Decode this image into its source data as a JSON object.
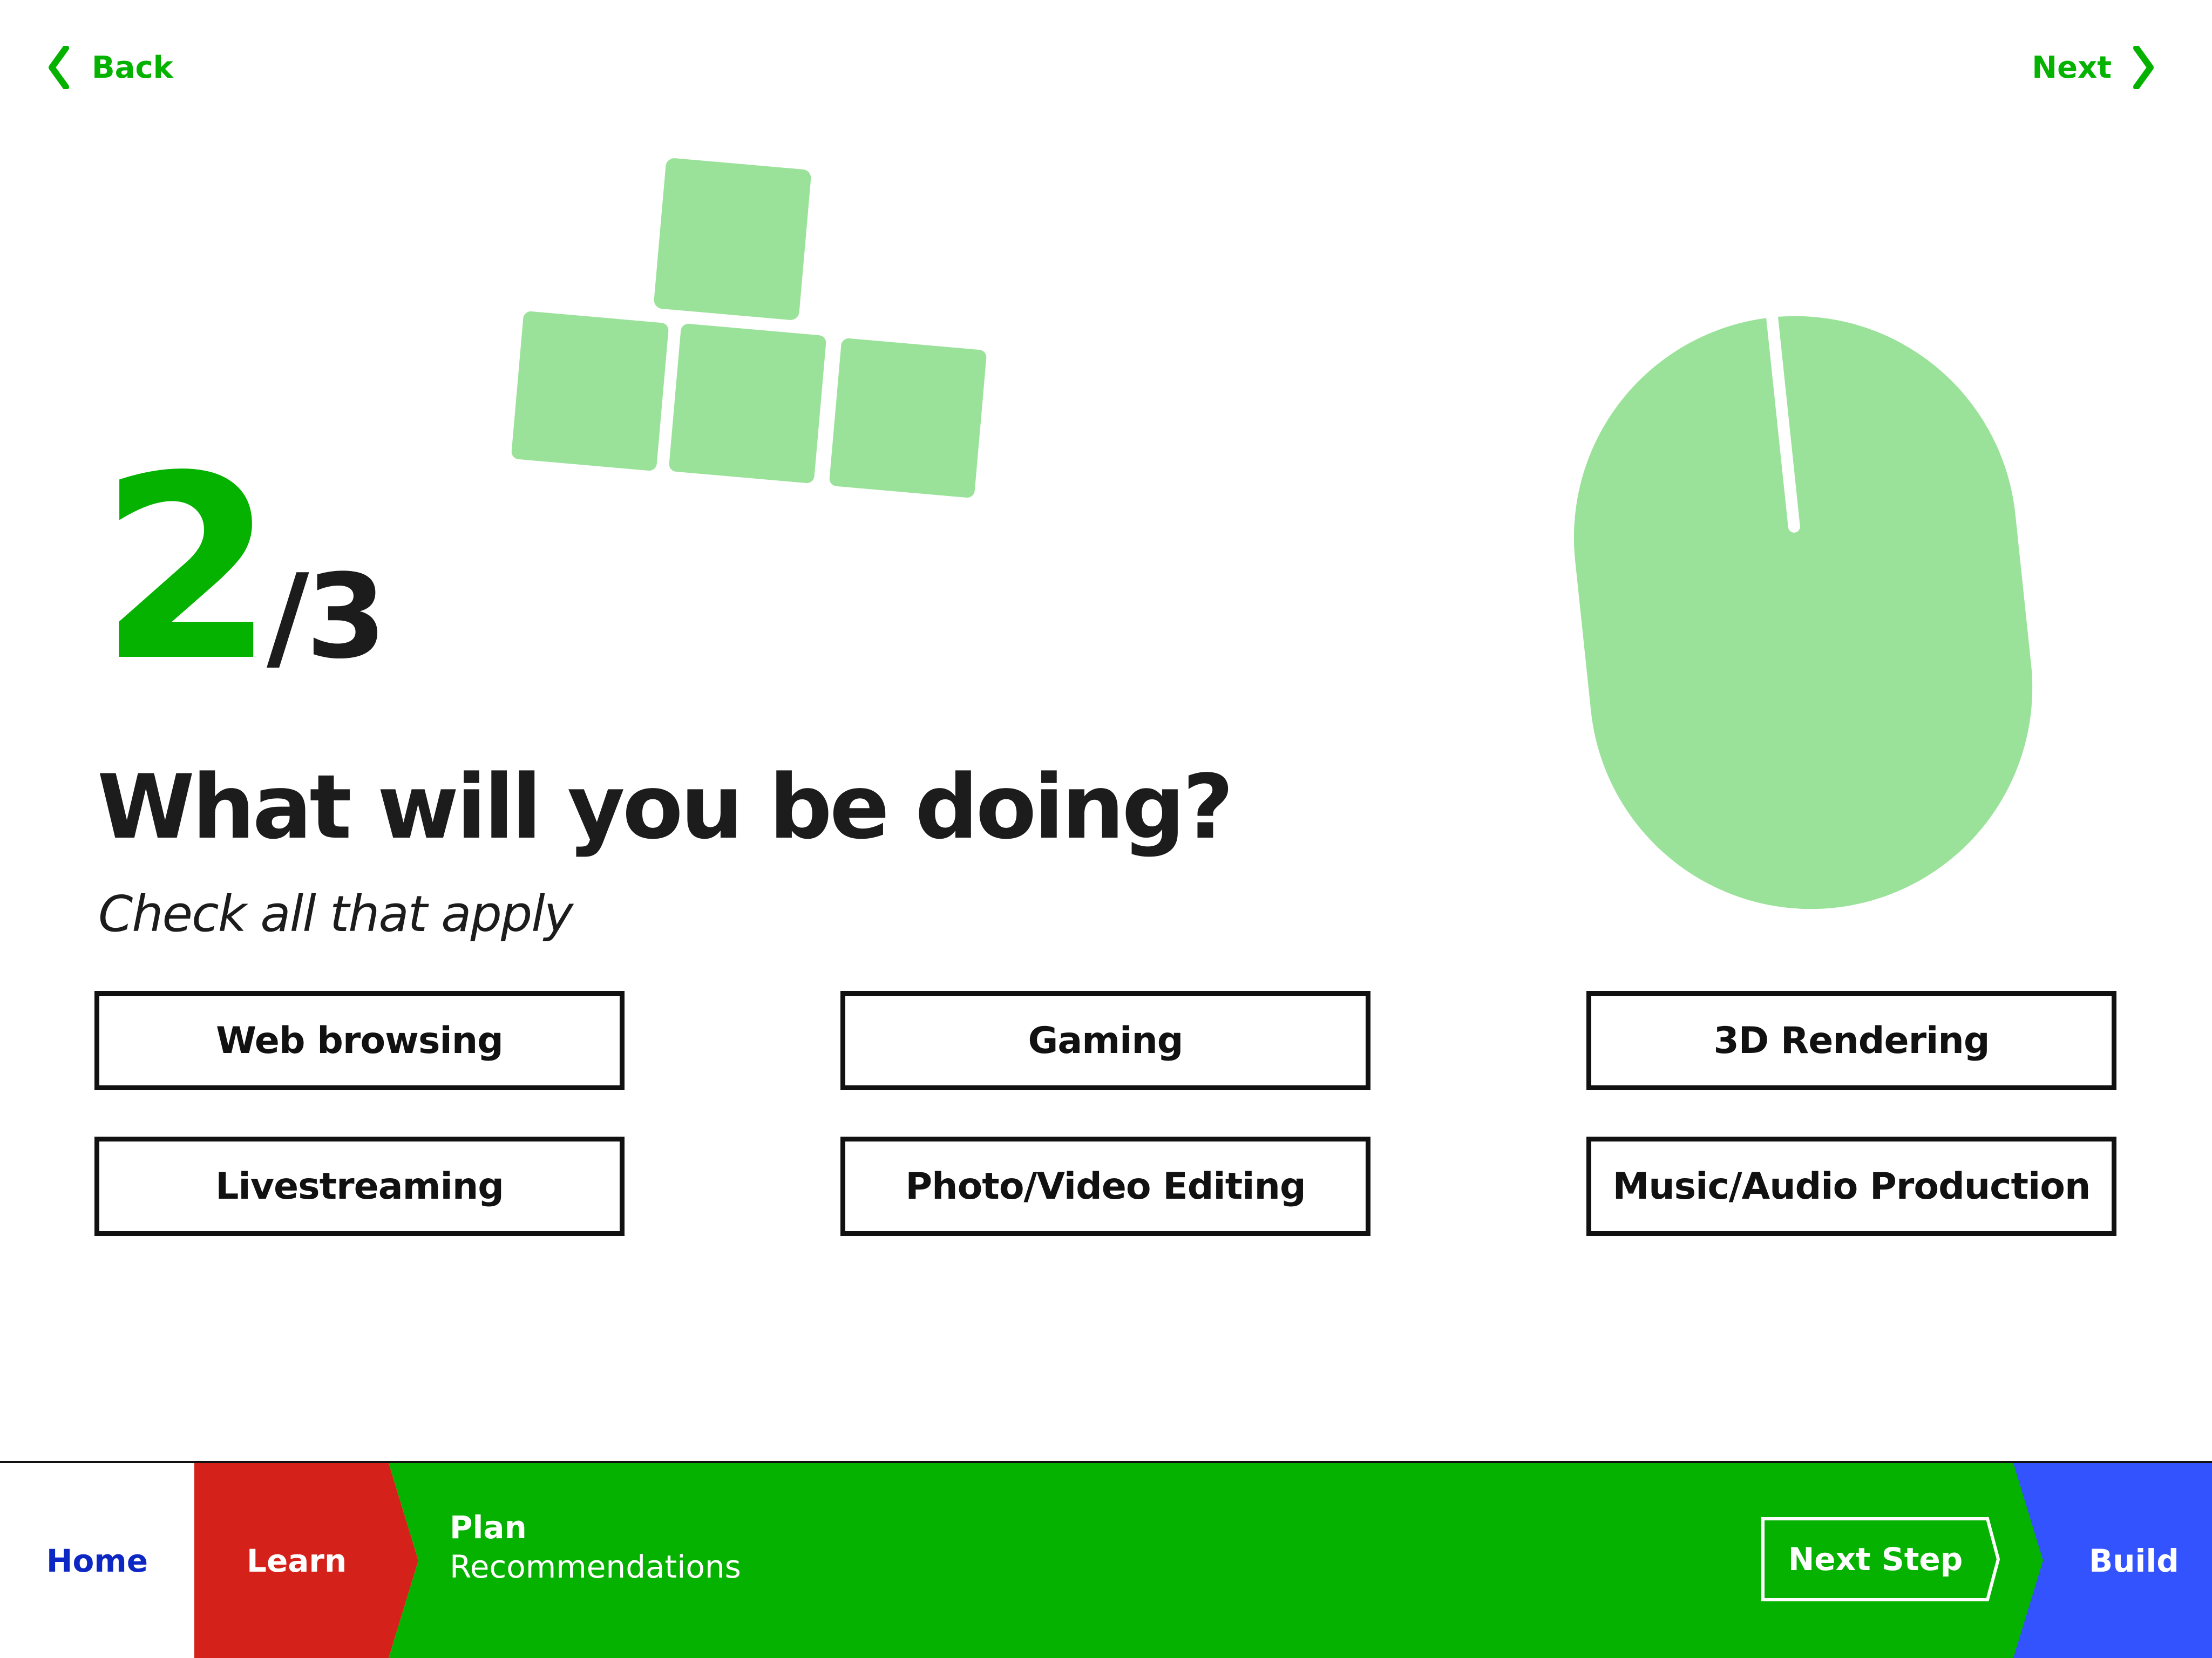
{
  "nav": {
    "back_label": "Back",
    "next_label": "Next"
  },
  "progress": {
    "current": "2",
    "total": "/3"
  },
  "question": {
    "title": "What will you be doing?",
    "subtitle": "Check all that apply"
  },
  "options": [
    {
      "label": "Web browsing"
    },
    {
      "label": "Gaming"
    },
    {
      "label": "3D Rendering"
    },
    {
      "label": "Livestreaming"
    },
    {
      "label": "Photo/Video Editing"
    },
    {
      "label": "Music/Audio Production"
    }
  ],
  "step_bar": {
    "home_label": "Home",
    "learn_label": "Learn",
    "plan_title": "Plan",
    "plan_subtitle": "Recommendations",
    "next_step_label": "Next Step",
    "build_label": "Build"
  },
  "colors": {
    "accent_green": "#05b200",
    "illustration_green": "#9ae29a",
    "learn_red": "#d4211a",
    "build_blue": "#3353ff",
    "home_blue": "#0c27c4",
    "text_dark": "#1c1c1c"
  },
  "icons": {
    "back": "chevron-left-icon",
    "next": "chevron-right-icon",
    "keys_illustration": "keyboard-keys-icon",
    "mouse_illustration": "computer-mouse-icon"
  }
}
